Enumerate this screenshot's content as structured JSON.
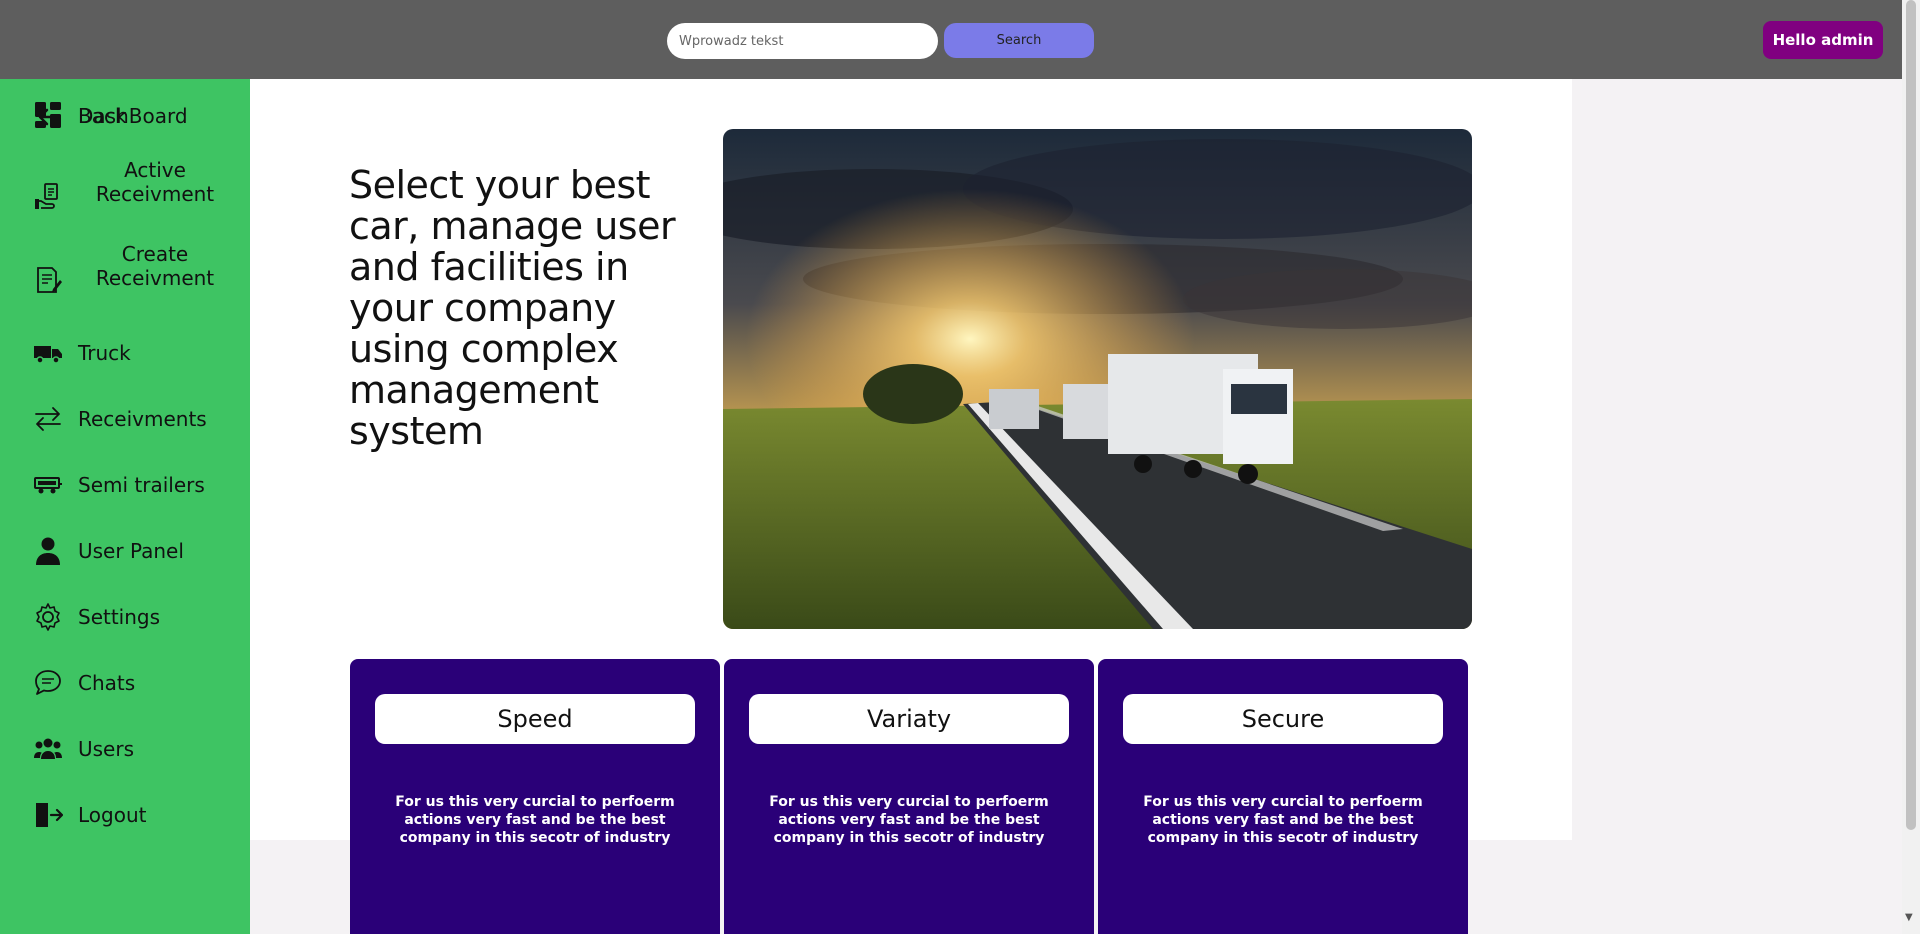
{
  "header": {
    "search_placeholder": "Wprowadz tekst",
    "search_value": "",
    "search_button": "Search",
    "user_button": "Hello admin"
  },
  "sidebar": {
    "items": [
      {
        "label": "Back",
        "icon": "arrow-left-icon"
      },
      {
        "label": "DashBoard",
        "icon": "dashboard-icon"
      },
      {
        "label": "Active Receivment",
        "icon": "hand-document-icon"
      },
      {
        "label": "Create Receivment",
        "icon": "edit-document-icon"
      },
      {
        "label": "Truck",
        "icon": "truck-icon"
      },
      {
        "label": "Receivments",
        "icon": "arrows-exchange-icon"
      },
      {
        "label": "Semi trailers",
        "icon": "trailer-icon"
      },
      {
        "label": "User Panel",
        "icon": "user-icon"
      },
      {
        "label": "Settings",
        "icon": "gear-icon"
      },
      {
        "label": "Chats",
        "icon": "chat-icon"
      },
      {
        "label": "Users",
        "icon": "users-icon"
      },
      {
        "label": "Logout",
        "icon": "logout-icon"
      }
    ]
  },
  "hero": {
    "text": "Select your best car, manage user and facilities in your company using complex management system",
    "image": "trucks-on-highway-at-sunset"
  },
  "cards": [
    {
      "title": "Speed",
      "text": "For us this very curcial to perfoerm actions very fast and be the best company in this secotr of industry"
    },
    {
      "title": "Variaty",
      "text": "For us this very curcial to perfoerm actions very fast and be the best company in this secotr of industry"
    },
    {
      "title": "Secure",
      "text": "For us this very curcial to perfoerm actions very fast and be the best company in this secotr of industry"
    }
  ],
  "colors": {
    "topbar": "#5e5e5e",
    "sidebar": "#3ec463",
    "search_button": "#7b7be8",
    "user_button": "#800080",
    "card": "#2a0078"
  }
}
